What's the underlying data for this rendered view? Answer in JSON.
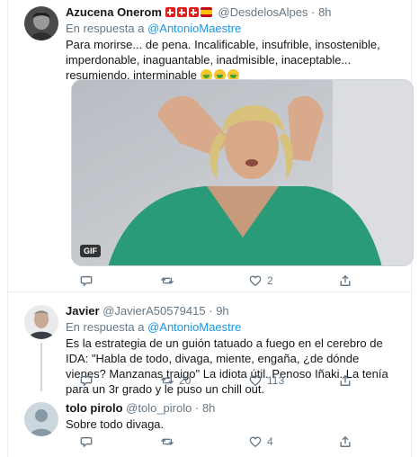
{
  "tweets": [
    {
      "name": "Azucena Onerom",
      "handle": "@DesdelosAlpes",
      "time": "8h",
      "reply_prefix": "En respuesta a",
      "reply_to": "@AntonioMaestre",
      "text": "Para morirse... de pena. Incalificable, insufrible, insostenible, imperdonable, inaguantable, inadmisible, inaceptable... resumiendo, interminable",
      "emoji": [
        "money-mouth-face-emoji",
        "money-mouth-face-emoji",
        "money-mouth-face-emoji"
      ],
      "media_badge": "GIF",
      "actions": {
        "reply": "",
        "retweet": "",
        "like": "2",
        "share": ""
      }
    },
    {
      "name": "Javier",
      "handle": "@JavierA50579415",
      "time": "9h",
      "reply_prefix": "En respuesta a",
      "reply_to": "@AntonioMaestre",
      "text": "Es la estrategia de un guión tatuado a fuego en el cerebro de IDA: \"Habla de todo, divaga, miente, engaña, ¿de dónde vienes? Manzanas traigo\" La idiota útil. Penoso Iñaki. La tenía para un 3r grado y le puso un chill out.",
      "actions": {
        "reply": "",
        "retweet": "20",
        "like": "113",
        "share": ""
      }
    },
    {
      "name": "tolo pirolo",
      "handle": "@tolo_pirolo",
      "time": "8h",
      "text": "Sobre todo divaga.",
      "actions": {
        "reply": "",
        "retweet": "",
        "like": "4",
        "share": ""
      }
    }
  ],
  "separator": "·",
  "colors": {
    "link": "#1b95e0",
    "secondary": "#657786",
    "text": "#14171a",
    "border": "#e6ecf0"
  }
}
